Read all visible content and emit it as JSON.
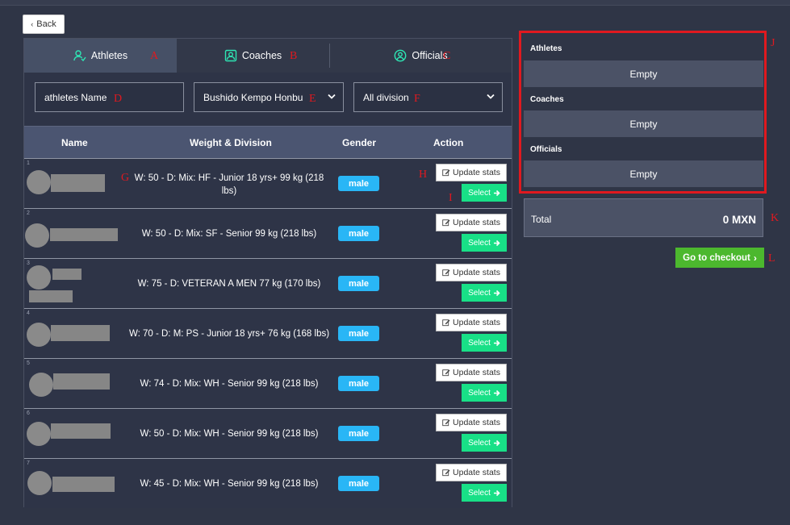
{
  "nav": {
    "back_label": "Back"
  },
  "annotations": [
    "A",
    "B",
    "C",
    "D",
    "E",
    "F",
    "G",
    "H",
    "I",
    "J",
    "K",
    "L"
  ],
  "tabs": [
    {
      "label": "Athletes",
      "icon": "user-check-icon"
    },
    {
      "label": "Coaches",
      "icon": "id-badge-icon"
    },
    {
      "label": "Officials",
      "icon": "user-circle-icon"
    }
  ],
  "filters": {
    "name_value": "athletes Name",
    "club_value": "Bushido Kempo Honbu",
    "division_value": "All division"
  },
  "table": {
    "headers": [
      "Name",
      "Weight & Division",
      "Gender",
      "Action"
    ],
    "update_label": "Update stats",
    "select_label": "Select",
    "rows": [
      {
        "num": "1",
        "wd": "W: 50 - D: Mix: HF - Junior 18 yrs+ 99 kg (218 lbs)",
        "gender": "male"
      },
      {
        "num": "2",
        "wd": "W: 50 - D: Mix: SF - Senior 99 kg (218 lbs)",
        "gender": "male"
      },
      {
        "num": "3",
        "wd": "W: 75 - D: VETERAN A MEN 77 kg (170 lbs)",
        "gender": "male"
      },
      {
        "num": "4",
        "wd": "W: 70 - D: M: PS - Junior 18 yrs+ 76 kg (168 lbs)",
        "gender": "male"
      },
      {
        "num": "5",
        "wd": "W: 74 - D: Mix: WH - Senior 99 kg (218 lbs)",
        "gender": "male"
      },
      {
        "num": "6",
        "wd": "W: 50 - D: Mix: WH - Senior 99 kg (218 lbs)",
        "gender": "male"
      },
      {
        "num": "7",
        "wd": "W: 45 - D: Mix: WH - Senior 99 kg (218 lbs)",
        "gender": "male"
      }
    ]
  },
  "summary": {
    "sections": [
      {
        "title": "Athletes",
        "value": "Empty"
      },
      {
        "title": "Coaches",
        "value": "Empty"
      },
      {
        "title": "Officials",
        "value": "Empty"
      }
    ],
    "total_label": "Total",
    "total_value": "0 MXN",
    "checkout_label": "Go to checkout"
  },
  "colors": {
    "accent_green": "#18e087",
    "checkout_green": "#4cb82e",
    "gender_badge": "#29b6f6",
    "annotation_red": "#e0191f",
    "tab_icon": "#2ee6b4"
  }
}
